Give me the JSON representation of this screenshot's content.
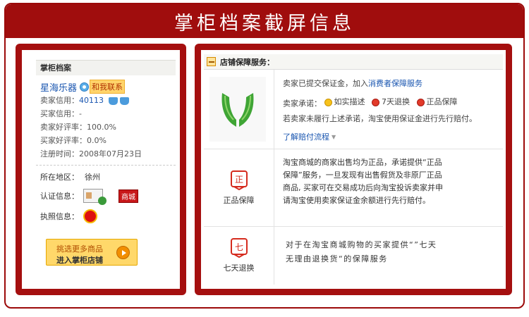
{
  "banner": {
    "title": "掌柜档案截屏信息"
  },
  "profile": {
    "section_title": "掌柜档案",
    "seller_name": "星海乐器",
    "contact_label": "和我联系",
    "seller_credit_label": "卖家信用：",
    "seller_credit_value": "40113",
    "buyer_credit_label": "买家信用：",
    "buyer_credit_value": "-",
    "seller_good_rate": "卖家好评率：100.0%",
    "buyer_good_rate": "买家好评率：0.0%",
    "register_time": "注册时间：2008年07月23日",
    "region_label": "所在地区：",
    "region_value": "徐州",
    "cert_label": "认证信息：",
    "mall_badge": "商城",
    "license_label": "执照信息：",
    "shop_button": {
      "line1": "挑选更多商品",
      "line2": "进入掌柜店铺"
    }
  },
  "guarantee": {
    "header": "店铺保障服务：",
    "deposit_text": "卖家已提交保证金，加入",
    "deposit_link": "消费者保障服务",
    "promise_label": "卖家承诺：",
    "promises": [
      "如实描述",
      "7天退换",
      "正品保障"
    ],
    "fallback_text": "若卖家未履行上述承诺，淘宝使用保证金进行先行赔付。",
    "learn_link": "了解赔付流程",
    "genuine": {
      "label": "正品保障",
      "icon_char": "正",
      "lines": [
        "淘宝商城的商家出售均为正品，承诺提供“正品",
        "保障”服务，一旦发现有出售假货及非原厂正品",
        "商品, 买家可在交易成功后向淘宝投诉卖家并申",
        "请淘宝使用卖家保证金余额进行先行赔付。"
      ]
    },
    "return7": {
      "label": "七天退换",
      "icon_char": "七",
      "lines": [
        "对于在淘宝商城购物的买家提供“”七天",
        "无理由退换货“的保障服务"
      ]
    }
  },
  "colors": {
    "frame_red": "#a00d0d",
    "link_blue": "#1a56b0",
    "button_yellow": "#ffd86a"
  }
}
